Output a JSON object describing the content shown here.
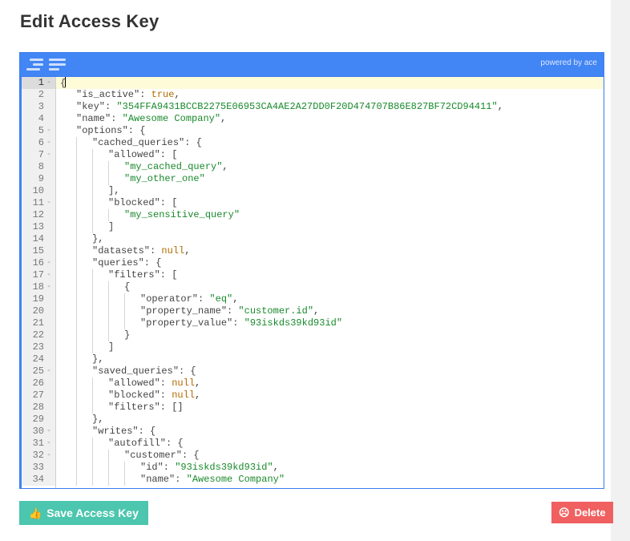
{
  "page": {
    "title": "Edit Access Key",
    "background_color": "#f1f1f1",
    "card_color": "#ffffff"
  },
  "editor": {
    "toolbar": {
      "accent_color": "#4285f4",
      "icons": [
        {
          "name": "format-indent-icon",
          "label": "format indent"
        },
        {
          "name": "format-align-left-icon",
          "label": "align left"
        }
      ],
      "credit": "powered by ace"
    },
    "cursor_line": 1,
    "total_visible_lines": 34,
    "lines": [
      {
        "n": "1",
        "fold": "-",
        "indent": 0,
        "text": "{"
      },
      {
        "n": "2",
        "fold": "",
        "indent": 1,
        "text": "\"is_active\": true,"
      },
      {
        "n": "3",
        "fold": "",
        "indent": 1,
        "text": "\"key\": \"354FFA9431BCCB2275E06953CA4AE2A27DD0F20D474707B86E827BF72CD94411\","
      },
      {
        "n": "4",
        "fold": "",
        "indent": 1,
        "text": "\"name\": \"Awesome Company\","
      },
      {
        "n": "5",
        "fold": "-",
        "indent": 1,
        "text": "\"options\": {"
      },
      {
        "n": "6",
        "fold": "-",
        "indent": 2,
        "text": "\"cached_queries\": {"
      },
      {
        "n": "7",
        "fold": "-",
        "indent": 3,
        "text": "\"allowed\": ["
      },
      {
        "n": "8",
        "fold": "",
        "indent": 4,
        "text": "\"my_cached_query\","
      },
      {
        "n": "9",
        "fold": "",
        "indent": 4,
        "text": "\"my_other_one\""
      },
      {
        "n": "10",
        "fold": "",
        "indent": 3,
        "text": "],"
      },
      {
        "n": "11",
        "fold": "-",
        "indent": 3,
        "text": "\"blocked\": ["
      },
      {
        "n": "12",
        "fold": "",
        "indent": 4,
        "text": "\"my_sensitive_query\""
      },
      {
        "n": "13",
        "fold": "",
        "indent": 3,
        "text": "]"
      },
      {
        "n": "14",
        "fold": "",
        "indent": 2,
        "text": "},"
      },
      {
        "n": "15",
        "fold": "",
        "indent": 2,
        "text": "\"datasets\": null,"
      },
      {
        "n": "16",
        "fold": "-",
        "indent": 2,
        "text": "\"queries\": {"
      },
      {
        "n": "17",
        "fold": "-",
        "indent": 3,
        "text": "\"filters\": ["
      },
      {
        "n": "18",
        "fold": "-",
        "indent": 4,
        "text": "{"
      },
      {
        "n": "19",
        "fold": "",
        "indent": 5,
        "text": "\"operator\": \"eq\","
      },
      {
        "n": "20",
        "fold": "",
        "indent": 5,
        "text": "\"property_name\": \"customer.id\","
      },
      {
        "n": "21",
        "fold": "",
        "indent": 5,
        "text": "\"property_value\": \"93iskds39kd93id\""
      },
      {
        "n": "22",
        "fold": "",
        "indent": 4,
        "text": "}"
      },
      {
        "n": "23",
        "fold": "",
        "indent": 3,
        "text": "]"
      },
      {
        "n": "24",
        "fold": "",
        "indent": 2,
        "text": "},"
      },
      {
        "n": "25",
        "fold": "-",
        "indent": 2,
        "text": "\"saved_queries\": {"
      },
      {
        "n": "26",
        "fold": "",
        "indent": 3,
        "text": "\"allowed\": null,"
      },
      {
        "n": "27",
        "fold": "",
        "indent": 3,
        "text": "\"blocked\": null,"
      },
      {
        "n": "28",
        "fold": "",
        "indent": 3,
        "text": "\"filters\": []"
      },
      {
        "n": "29",
        "fold": "",
        "indent": 2,
        "text": "},"
      },
      {
        "n": "30",
        "fold": "-",
        "indent": 2,
        "text": "\"writes\": {"
      },
      {
        "n": "31",
        "fold": "-",
        "indent": 3,
        "text": "\"autofill\": {"
      },
      {
        "n": "32",
        "fold": "-",
        "indent": 4,
        "text": "\"customer\": {"
      },
      {
        "n": "33",
        "fold": "",
        "indent": 5,
        "text": "\"id\": \"93iskds39kd93id\","
      },
      {
        "n": "34",
        "fold": "",
        "indent": 5,
        "text": "\"name\": \"Awesome Company\""
      }
    ]
  },
  "footer": {
    "save": {
      "label": "Save Access Key",
      "icon": "thumbs-up-icon",
      "glyph": "👍",
      "color": "#4cc6ae"
    },
    "delete": {
      "label": "Delete",
      "icon": "frowning-face-icon",
      "glyph": "☹",
      "color": "#f06060"
    }
  }
}
